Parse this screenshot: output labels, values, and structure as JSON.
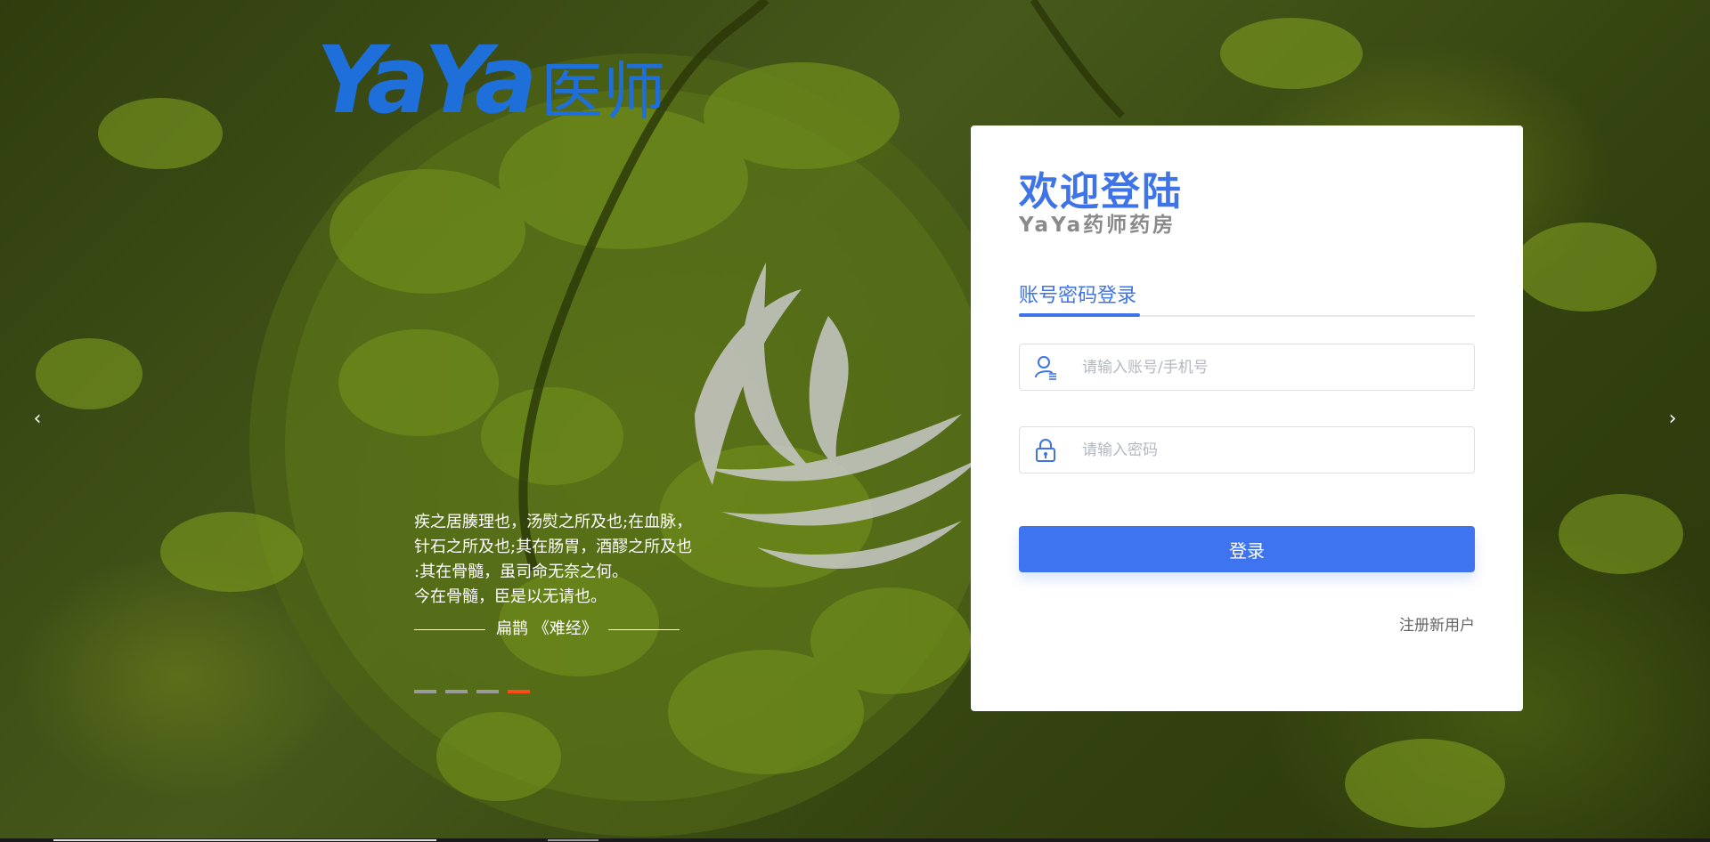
{
  "logo": {
    "latin": "YaYa",
    "cn": "医师"
  },
  "quote": {
    "lines": [
      "疾之居腠理也，汤熨之所及也;在血脉，",
      "针石之所及也;其在肠胃，酒醪之所及也",
      ":其在骨髓，虽司命无奈之何。",
      "今在骨髓，臣是以无请也。"
    ],
    "author": "扁鹊 《难经》"
  },
  "carousel": {
    "prev": "‹",
    "next": "›",
    "slide_count": 4,
    "active_index": 3
  },
  "login": {
    "welcome": "欢迎登陆",
    "subtitle": "YaYa药师药房",
    "tab_label": "账号密码登录",
    "username_placeholder": "请输入账号/手机号",
    "password_placeholder": "请输入密码",
    "login_button": "登录",
    "register_link": "注册新用户"
  },
  "colors": {
    "accent": "#3f74e8",
    "logo": "#1e6fd9",
    "active_dot": "#ff4a1c"
  },
  "icons": {
    "user_field": "user-icon",
    "password_field": "lock-icon",
    "prev": "chevron-left-icon",
    "next": "chevron-right-icon"
  }
}
